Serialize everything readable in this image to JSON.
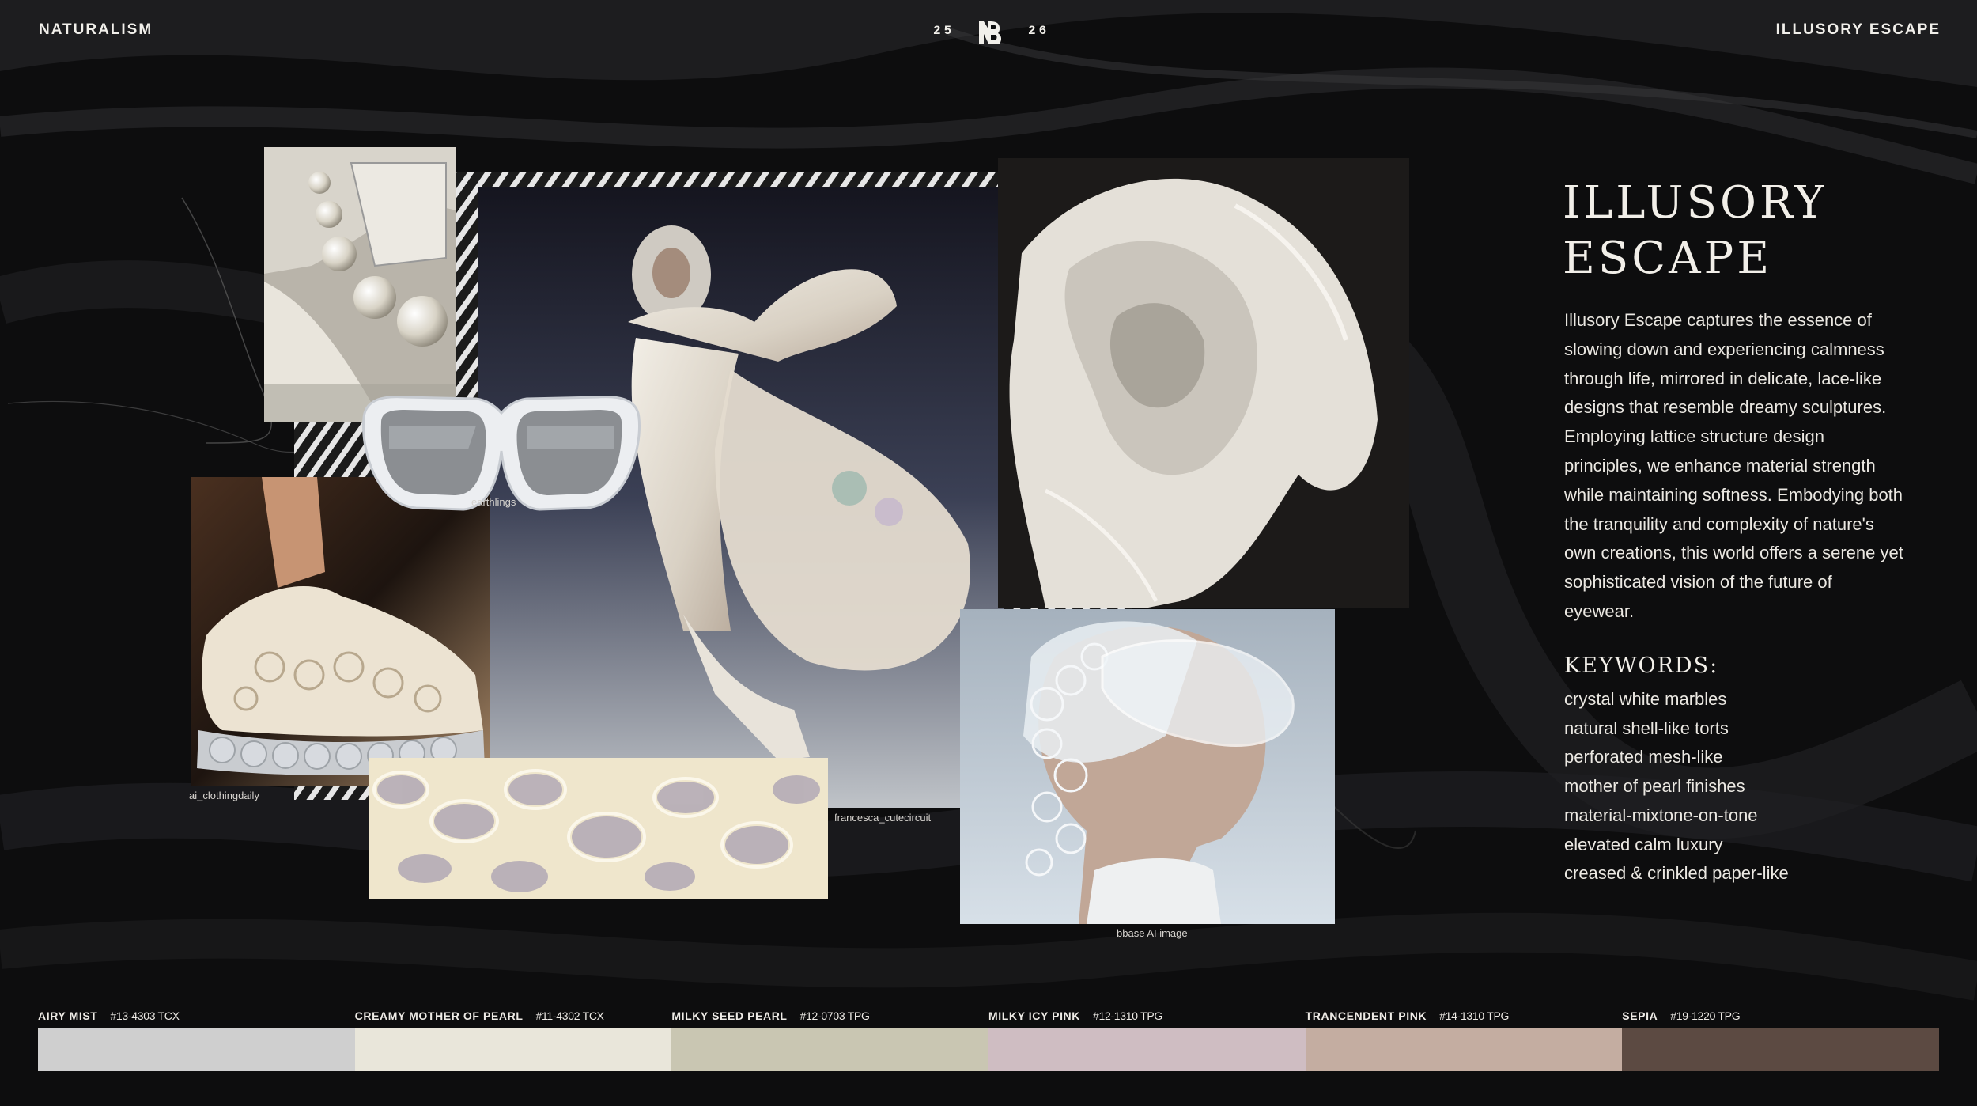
{
  "header": {
    "left": "NATURALISM",
    "right": "ILLUSORY ESCAPE",
    "year_left": "25",
    "year_right": "26",
    "logo_icon": "brand-logo-icon"
  },
  "captions": {
    "sunglasses": "earthlings",
    "sneaker": "ai_clothingdaily",
    "floating_figure": "francesca_cutecircuit",
    "goggles_portrait": "bbase AI image"
  },
  "text": {
    "title_line1": "ILLUSORY",
    "title_line2": "ESCAPE",
    "body": "Illusory Escape captures the essence of slowing down and experiencing calmness through life, mirrored in delicate, lace-like designs that resemble dreamy sculptures. Employing lattice structure design principles, we enhance material strength while maintaining softness. Embodying both the tranquility and complexity of nature's own creations, this world offers a serene yet sophisticated vision of the future of eyewear.",
    "keywords_heading": "KEYWORDS:",
    "keywords": [
      "crystal white marbles",
      "natural shell-like torts",
      "perforated mesh-like",
      "mother of pearl finishes",
      "material-mixtone-on-tone",
      "elevated calm luxury",
      "creased & crinkled paper-like"
    ]
  },
  "palette": [
    {
      "name": "AIRY MIST",
      "code": "#13-4303 TCX",
      "color": "#cfcfcf"
    },
    {
      "name": "CREAMY MOTHER OF PEARL",
      "code": "#11-4302 TCX",
      "color": "#e9e6da"
    },
    {
      "name": "MILKY SEED PEARL",
      "code": "#12-0703 TPG",
      "color": "#c9c6b2"
    },
    {
      "name": "MILKY ICY PINK",
      "code": "#12-1310 TPG",
      "color": "#cfbdc2"
    },
    {
      "name": "TRANCENDENT PINK",
      "code": "#14-1310 TPG",
      "color": "#c4ada1"
    },
    {
      "name": "SEPIA",
      "code": "#19-1220 TPG",
      "color": "#5c4a42"
    }
  ]
}
